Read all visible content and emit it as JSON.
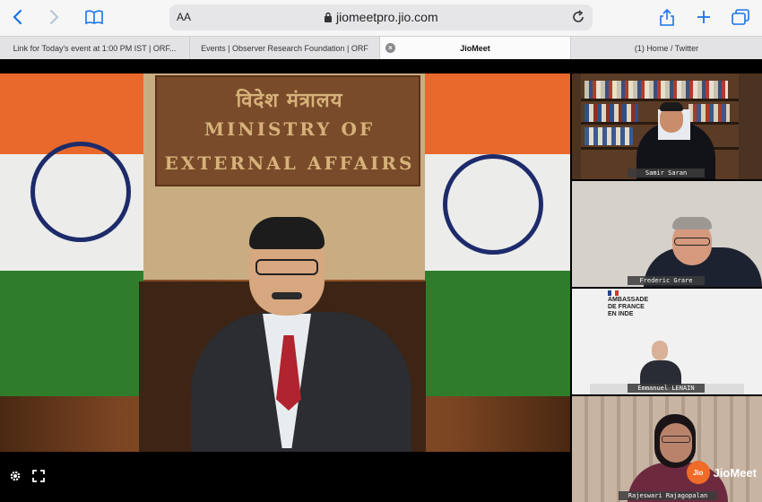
{
  "browser": {
    "text_size_label": "AA",
    "url": "jiomeetpro.jio.com"
  },
  "tabs": [
    {
      "label": "Link for Today's event at 1:00 PM IST | ORF..."
    },
    {
      "label": "Events | Observer Research Foundation | ORF"
    },
    {
      "label": "JioMeet",
      "active": true
    },
    {
      "label": "(1) Home / Twitter"
    }
  ],
  "main_video": {
    "plaque_hindi": "विदेश मंत्रालय",
    "plaque_line1": "MINISTRY OF",
    "plaque_line2": "EXTERNAL AFFAIRS"
  },
  "participants": [
    {
      "name": "Samir Saran"
    },
    {
      "name": "Frederic Grare"
    },
    {
      "name": "Emmanuel LENAIN",
      "sign_text_1": "AMBASSADE",
      "sign_text_2": "DE FRANCE",
      "sign_text_3": "EN INDE"
    },
    {
      "name": "Rajeswari Rajagopalan"
    }
  ],
  "brand": {
    "logo_badge": "Jio",
    "logo_text": "JioMeet",
    "accent_color": "#f06a28"
  },
  "icons": {
    "settings": "gear-icon",
    "fullscreen": "fullscreen-icon"
  }
}
